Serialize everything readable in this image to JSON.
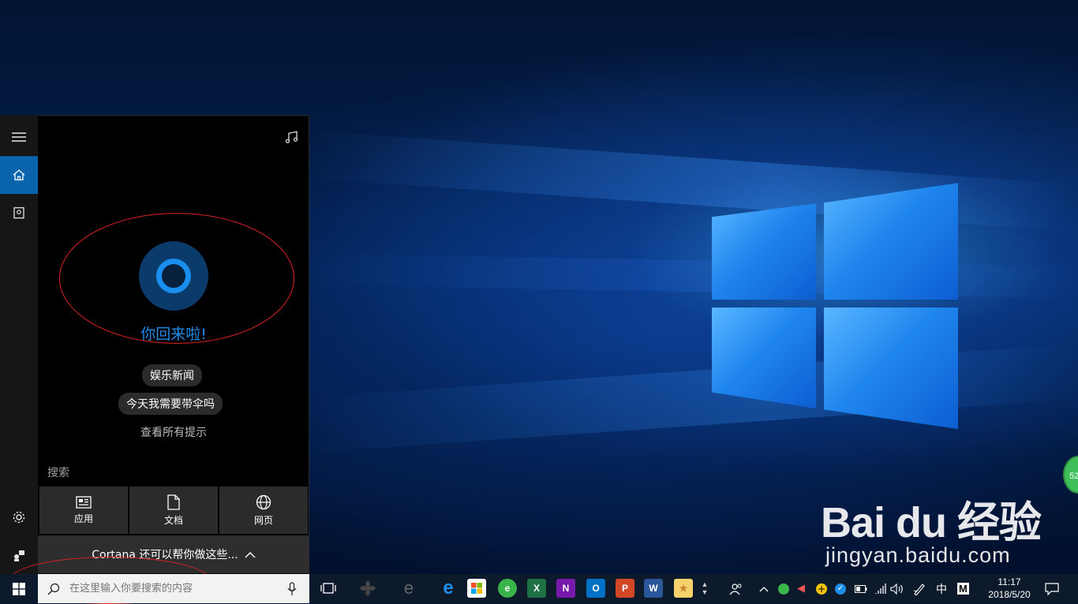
{
  "desktop": {
    "watermark_logo": "Bai du 经验",
    "watermark_url": "jingyan.baidu.com",
    "badge_number": "52"
  },
  "cortana": {
    "greeting": "你回来啦!",
    "suggestions": [
      "娱乐新闻",
      "今天我需要带伞吗"
    ],
    "see_all_tips": "查看所有提示",
    "search_heading": "搜索",
    "search_tiles": [
      {
        "label": "应用",
        "icon": "app-icon"
      },
      {
        "label": "文档",
        "icon": "document-icon"
      },
      {
        "label": "网页",
        "icon": "globe-icon"
      }
    ],
    "help_bar": "Cortana 还可以帮你做这些..."
  },
  "sidebar": {
    "items": [
      "menu-icon",
      "home-icon",
      "notebook-icon",
      "settings-icon",
      "feedback-icon"
    ]
  },
  "taskbar": {
    "search_placeholder": "在这里输入你要搜索的内容",
    "apps": [
      "task-view",
      "app-generic",
      "edge-legacy",
      "edge",
      "store",
      "browser-360",
      "excel",
      "onenote",
      "outlook",
      "powerpoint",
      "word",
      "sticky-app"
    ],
    "excel_letter": "X",
    "onenote_letter": "N",
    "outlook_letter": "O",
    "powerpoint_letter": "P",
    "word_letter": "W",
    "ime_lang": "中",
    "ime_mode": "M",
    "time": "11:17",
    "date": "2018/5/20"
  },
  "colors": {
    "accent": "#0a64ad",
    "cortana_blue": "#1e8ce8",
    "taskbar": "#0c1a2c"
  }
}
